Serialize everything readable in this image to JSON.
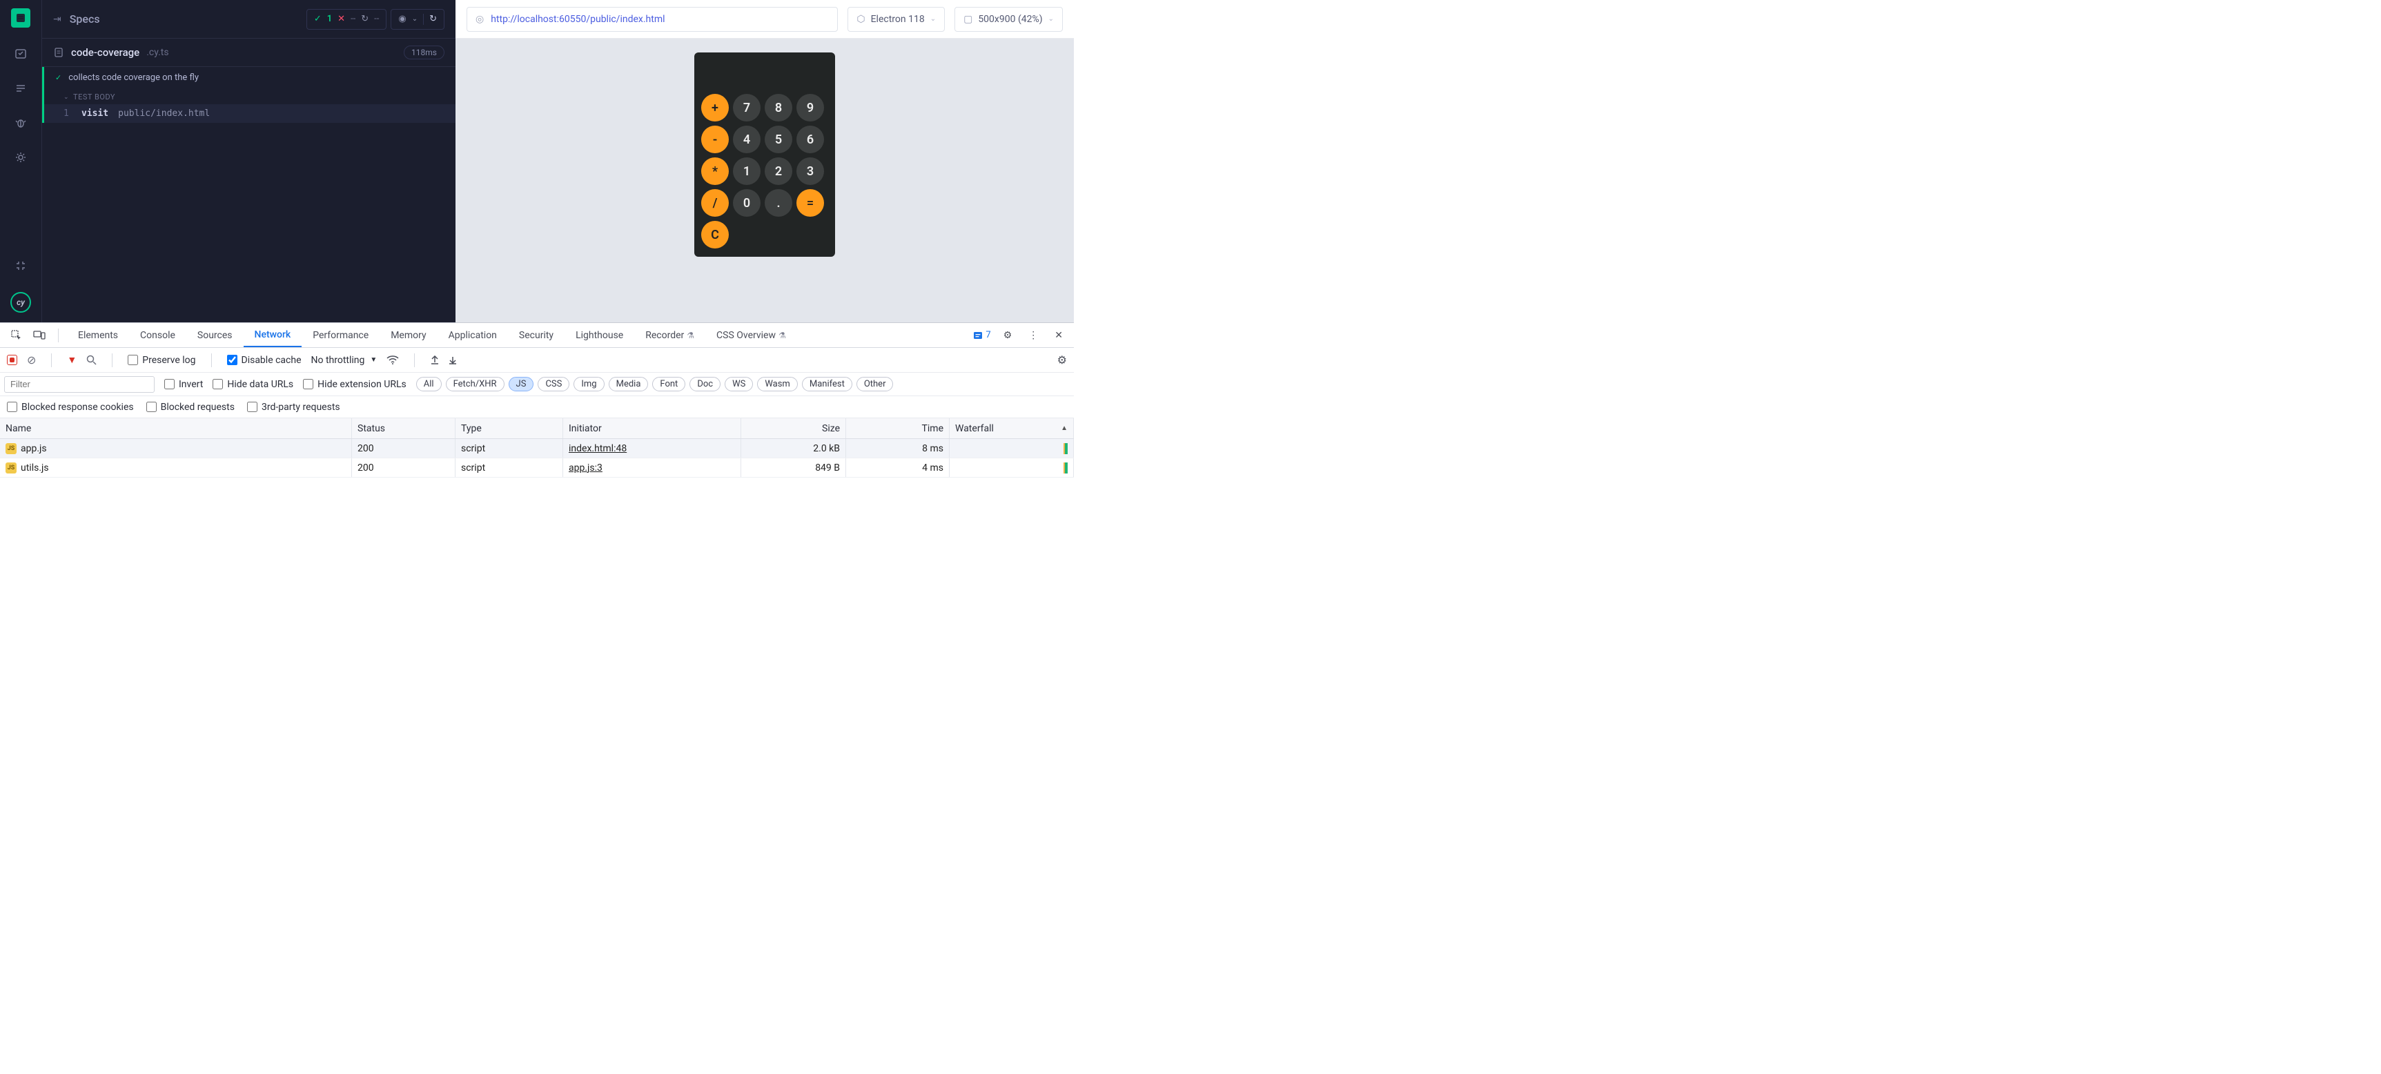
{
  "runner": {
    "title": "Specs",
    "stats": {
      "pass": "1",
      "dash": "--",
      "spin": "↻"
    },
    "spec": {
      "name": "code-coverage",
      "ext": ".cy.ts",
      "time": "118ms"
    },
    "test": {
      "title": "collects code coverage on the fly",
      "body_label": "TEST BODY",
      "cmd_num": "1",
      "cmd_name": "visit",
      "cmd_arg": "public/index.html"
    }
  },
  "preview": {
    "url": "http://localhost:60550/public/index.html",
    "browser": "Electron 118",
    "viewport": "500x900 (42%)"
  },
  "calc": {
    "rows": [
      [
        "+",
        "7",
        "8",
        "9"
      ],
      [
        "-",
        "4",
        "5",
        "6"
      ],
      [
        "*",
        "1",
        "2",
        "3"
      ],
      [
        "/",
        "0",
        ".",
        "="
      ],
      [
        "C",
        "",
        "",
        ""
      ]
    ]
  },
  "devtools": {
    "tabs": [
      "Elements",
      "Console",
      "Sources",
      "Network",
      "Performance",
      "Memory",
      "Application",
      "Security",
      "Lighthouse",
      "Recorder",
      "CSS Overview"
    ],
    "active_tab": "Network",
    "issues": "7",
    "preserve_log": "Preserve log",
    "disable_cache": "Disable cache",
    "throttling": "No throttling",
    "filter_placeholder": "Filter",
    "checks2": [
      "Invert",
      "Hide data URLs",
      "Hide extension URLs"
    ],
    "pills": [
      "All",
      "Fetch/XHR",
      "JS",
      "CSS",
      "Img",
      "Media",
      "Font",
      "Doc",
      "WS",
      "Wasm",
      "Manifest",
      "Other"
    ],
    "active_pill": "JS",
    "checks3": [
      "Blocked response cookies",
      "Blocked requests",
      "3rd-party requests"
    ],
    "columns": [
      "Name",
      "Status",
      "Type",
      "Initiator",
      "Size",
      "Time",
      "Waterfall"
    ],
    "rows": [
      {
        "name": "app.js",
        "status": "200",
        "type": "script",
        "initiator": "index.html:48",
        "size": "2.0 kB",
        "time": "8 ms"
      },
      {
        "name": "utils.js",
        "status": "200",
        "type": "script",
        "initiator": "app.js:3",
        "size": "849 B",
        "time": "4 ms"
      }
    ]
  }
}
